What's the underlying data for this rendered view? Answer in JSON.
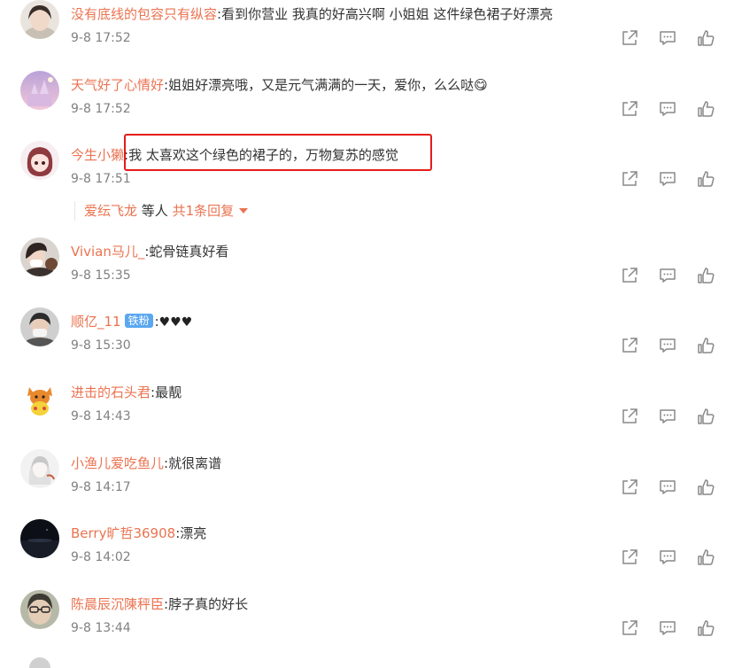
{
  "comments": [
    {
      "user": "没有底线的包容只有纵容",
      "sep": ":",
      "text": "看到你营业 我真的好高兴啊 小姐姐 这件绿色裙子好漂亮",
      "time": "9-8 17:52"
    },
    {
      "user": "天气好了心情好",
      "sep": ":",
      "text": "姐姐好漂亮哦，又是元气满满的一天，爱你，么么哒",
      "emoji": "😋",
      "time": "9-8 17:52"
    },
    {
      "user": "今生小獭",
      "sep": ":",
      "text": "我 太喜欢这个绿色的裙子的，万物复苏的感觉",
      "time": "9-8 17:51"
    },
    {
      "user": "Vivian马儿_",
      "sep": ":",
      "text": "蛇骨链真好看",
      "time": "9-8 15:35"
    },
    {
      "user": "顺亿_11",
      "badge": "铁粉",
      "sep": ":",
      "text": "♥♥♥",
      "time": "9-8 15:30"
    },
    {
      "user": "进击的石头君",
      "sep": ":",
      "text": "最靓",
      "time": "9-8 14:43"
    },
    {
      "user": "小渔儿爱吃鱼儿",
      "sep": ":",
      "text": "就很离谱",
      "time": "9-8 14:17"
    },
    {
      "user": "Berry旷哲36908",
      "sep": ":",
      "text": "漂亮",
      "time": "9-8 14:02"
    },
    {
      "user": "陈晨辰沉陳秤臣",
      "sep": ":",
      "text": "脖子真的好长",
      "time": "9-8 13:44"
    }
  ],
  "reply_summary": {
    "user": "爱纭飞龙",
    "middle": " 等人 ",
    "count": "共1条回复"
  },
  "icons": {
    "share": "share-icon",
    "comment": "comment-icon",
    "like": "like-icon"
  },
  "colors": {
    "username": "#eb7350",
    "highlight": "#e61b1b",
    "badge": "#5aa7f0"
  }
}
